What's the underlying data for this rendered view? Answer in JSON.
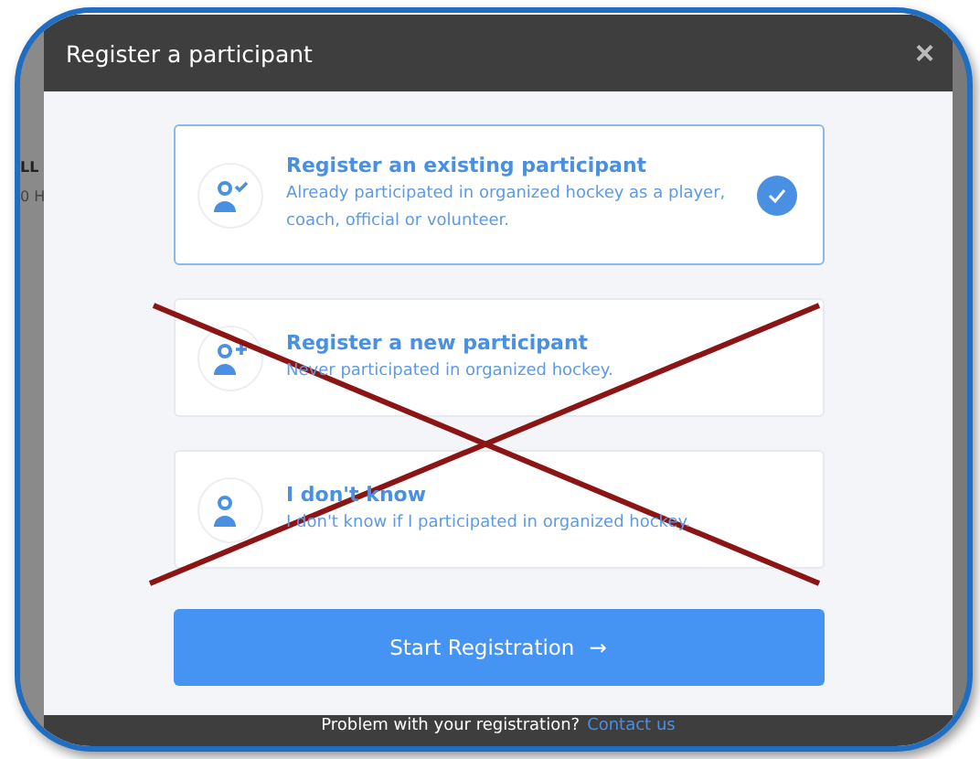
{
  "background_fragments": [
    "LL",
    "0 H"
  ],
  "dialog": {
    "title": "Register a participant",
    "close": "×"
  },
  "options": [
    {
      "kind": "existing",
      "title": "Register an existing participant",
      "description": "Already participated in organized hockey as a player, coach, official or volunteer.",
      "selected": true
    },
    {
      "kind": "new",
      "title": "Register a new participant",
      "description": "Never participated in organized hockey.",
      "selected": false
    },
    {
      "kind": "unknown",
      "title": "I don't know",
      "description": "I don't know if I participated in organized hockey.",
      "selected": false
    }
  ],
  "crossed_out": true,
  "start_button": {
    "label": "Start Registration",
    "arrow": "→"
  },
  "footer": {
    "text": "Problem with your registration?",
    "link": "Contact us"
  }
}
